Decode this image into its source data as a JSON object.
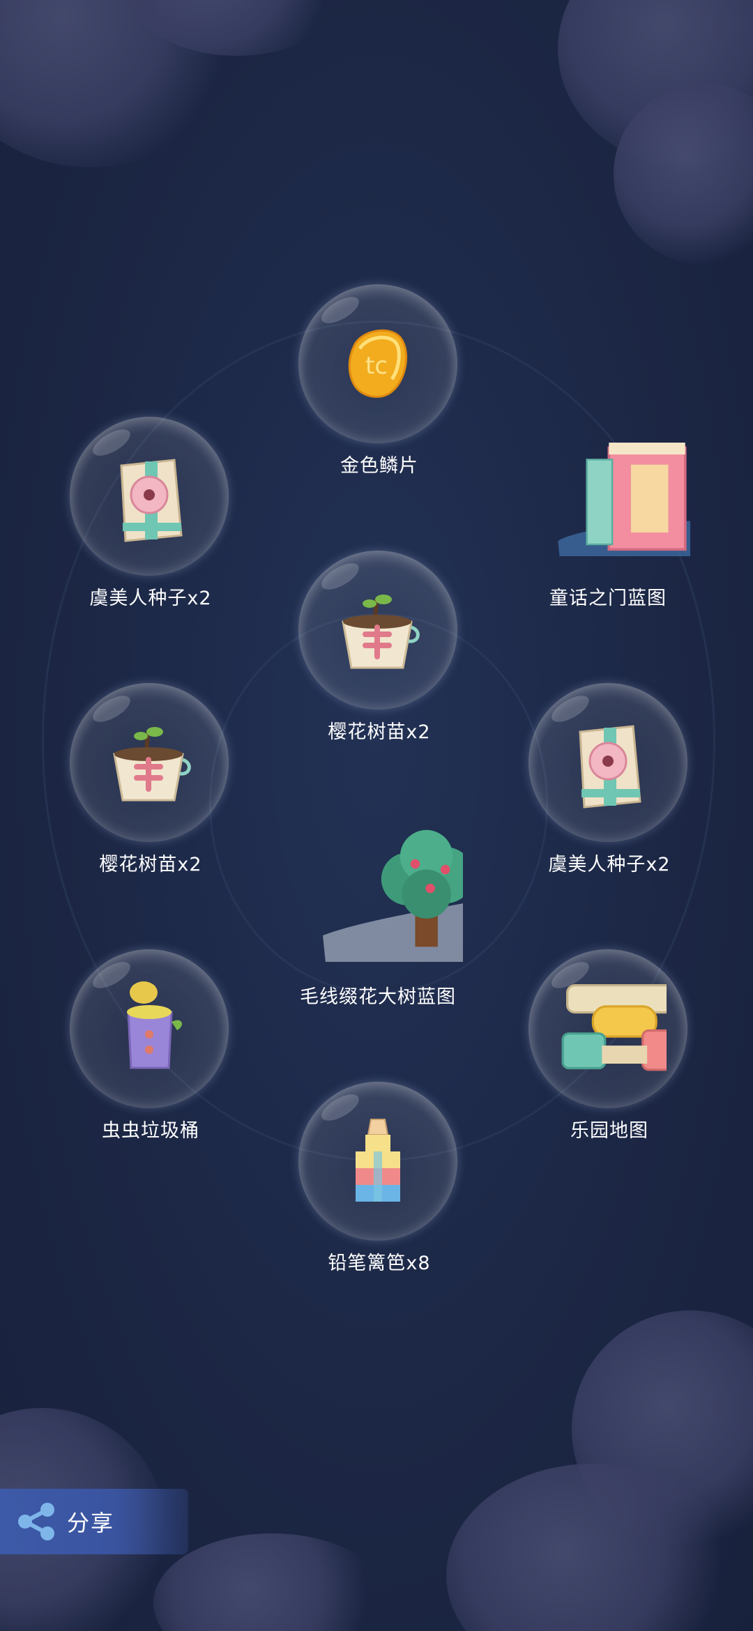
{
  "rewards": [
    {
      "id": "golden-scale",
      "label": "金色鳞片",
      "icon": "golden-scale-icon"
    },
    {
      "id": "yumeiren-seed-left",
      "label": "虞美人种子x2",
      "icon": "seed-pack-icon"
    },
    {
      "id": "fairy-door-blueprint",
      "label": "童话之门蓝图",
      "icon": "fairy-door-icon"
    },
    {
      "id": "sakura-sapling-center",
      "label": "樱花树苗x2",
      "icon": "sapling-pot-icon"
    },
    {
      "id": "sakura-sapling-left",
      "label": "樱花树苗x2",
      "icon": "sapling-pot-icon"
    },
    {
      "id": "yumeiren-seed-right",
      "label": "虞美人种子x2",
      "icon": "seed-pack-icon"
    },
    {
      "id": "yarn-flower-tree-blueprint",
      "label": "毛线缀花大树蓝图",
      "icon": "flower-tree-icon"
    },
    {
      "id": "bug-trash-can",
      "label": "虫虫垃圾桶",
      "icon": "trash-can-icon"
    },
    {
      "id": "park-map",
      "label": "乐园地图",
      "icon": "park-map-icon"
    },
    {
      "id": "pencil-fence",
      "label": "铅笔篱笆x8",
      "icon": "pencil-fence-icon"
    }
  ],
  "share": {
    "label": "分享",
    "icon": "share-icon"
  },
  "colors": {
    "background": "#1c2745",
    "share_button": "#3d5aa8",
    "text": "#ffffff"
  }
}
